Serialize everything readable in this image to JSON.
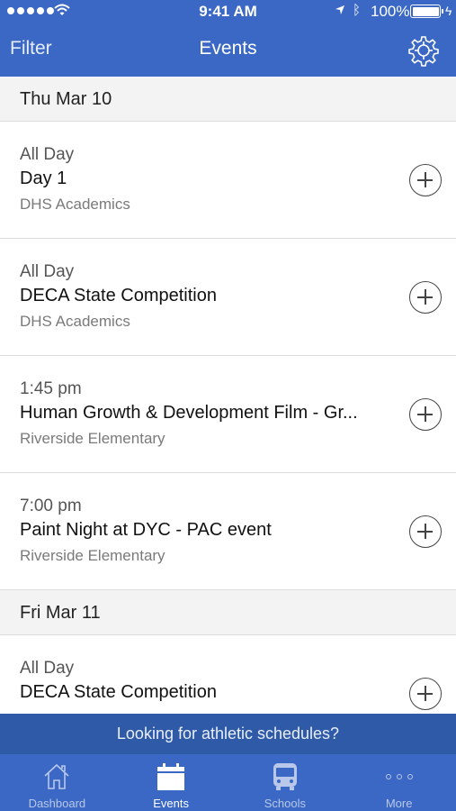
{
  "status_bar": {
    "time": "9:41 AM",
    "battery": "100%"
  },
  "nav": {
    "filter_label": "Filter",
    "title": "Events",
    "settings_icon": "gear-icon"
  },
  "days": [
    {
      "date": "Thu Mar 10",
      "events": [
        {
          "time": "All Day",
          "title": "Day 1",
          "school": "DHS Academics"
        },
        {
          "time": "All Day",
          "title": "DECA State Competition",
          "school": "DHS Academics"
        },
        {
          "time": "1:45 pm",
          "title": "Human Growth & Development Film - Gr...",
          "school": "Riverside Elementary"
        },
        {
          "time": "7:00 pm",
          "title": "Paint Night at DYC - PAC event",
          "school": "Riverside Elementary"
        }
      ]
    },
    {
      "date": "Fri Mar 11",
      "events": [
        {
          "time": "All Day",
          "title": "DECA State Competition",
          "school": ""
        }
      ]
    }
  ],
  "banner": {
    "text": "Looking for athletic schedules?"
  },
  "tabs": [
    {
      "label": "Dashboard",
      "icon": "home-icon",
      "active": false
    },
    {
      "label": "Events",
      "icon": "calendar-icon",
      "active": true
    },
    {
      "label": "Schools",
      "icon": "bus-icon",
      "active": false
    },
    {
      "label": "More",
      "icon": "more-dots-icon",
      "active": false
    }
  ],
  "colors": {
    "brand": "#3a68c4",
    "banner": "#2f5aa8"
  }
}
